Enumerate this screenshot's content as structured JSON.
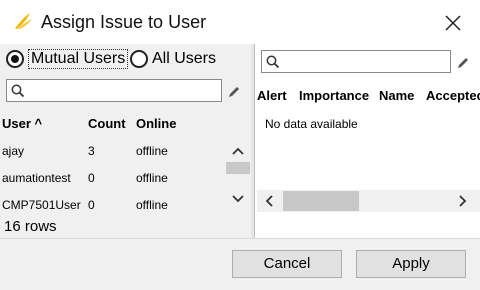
{
  "dialog": {
    "title": "Assign Issue to User",
    "app_icon": "wing-logo-icon",
    "close_icon": "close-icon"
  },
  "mode": {
    "options": [
      {
        "label": "Mutual Users",
        "selected": true
      },
      {
        "label": "All Users",
        "selected": false
      }
    ]
  },
  "left": {
    "search_value": "",
    "columns": [
      "User ^",
      "Count",
      "Online"
    ],
    "rows": [
      {
        "user": "ajay",
        "count": "3",
        "online": "offline"
      },
      {
        "user": "aumationtest",
        "count": "0",
        "online": "offline"
      },
      {
        "user": "CMP7501User",
        "count": "0",
        "online": "offline"
      }
    ],
    "row_count": "16 rows"
  },
  "right": {
    "search_value": "",
    "columns": [
      "Alert",
      "Importance",
      "Name",
      "Accepted"
    ],
    "empty_message": "No data available"
  },
  "buttons": {
    "cancel": "Cancel",
    "apply": "Apply"
  },
  "colors": {
    "accent": "#f2b600",
    "panel": "#f0f0f0",
    "button": "#e1e1e1"
  }
}
